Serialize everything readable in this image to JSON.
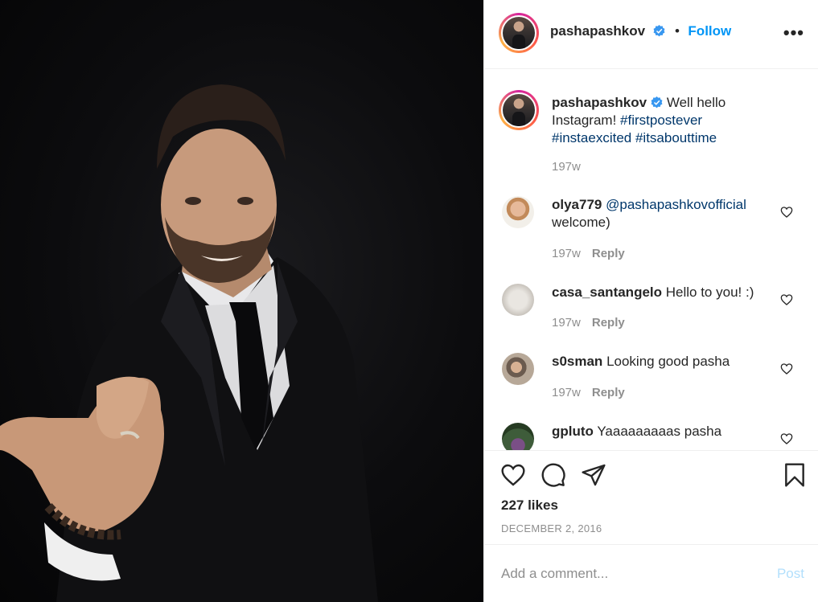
{
  "post": {
    "author": "pashapashkov",
    "follow_label": "Follow",
    "more_label": "•••",
    "dot": "•",
    "caption_text": "Well hello Instagram!",
    "caption_tags": [
      "#firstpostever",
      "#instaexcited",
      "#itsabouttime"
    ],
    "caption_time": "197w",
    "likes": "227 likes",
    "date": "December 2, 2016"
  },
  "comments": [
    {
      "user": "olya779",
      "mention": "@pashapashkovofficial",
      "text": "welcome)",
      "time": "197w",
      "reply": "Reply"
    },
    {
      "user": "casa_santangelo",
      "text": "Hello to you! :)",
      "time": "197w",
      "reply": "Reply"
    },
    {
      "user": "s0sman",
      "text": "Looking good pasha",
      "time": "197w",
      "reply": "Reply"
    },
    {
      "user": "gpluto",
      "text": "Yaaaaaaaaas pasha"
    }
  ],
  "add_comment": {
    "placeholder": "Add a comment...",
    "post_label": "Post"
  },
  "icons": [
    "verified-icon",
    "more-icon",
    "heart-icon",
    "comment-icon",
    "share-icon",
    "bookmark-icon"
  ],
  "colors": {
    "follow": "#0095f6",
    "hashtag": "#00376b",
    "verified": "#3897f0",
    "muted": "#8e8e8e",
    "post_disabled": "#b2dffc"
  }
}
